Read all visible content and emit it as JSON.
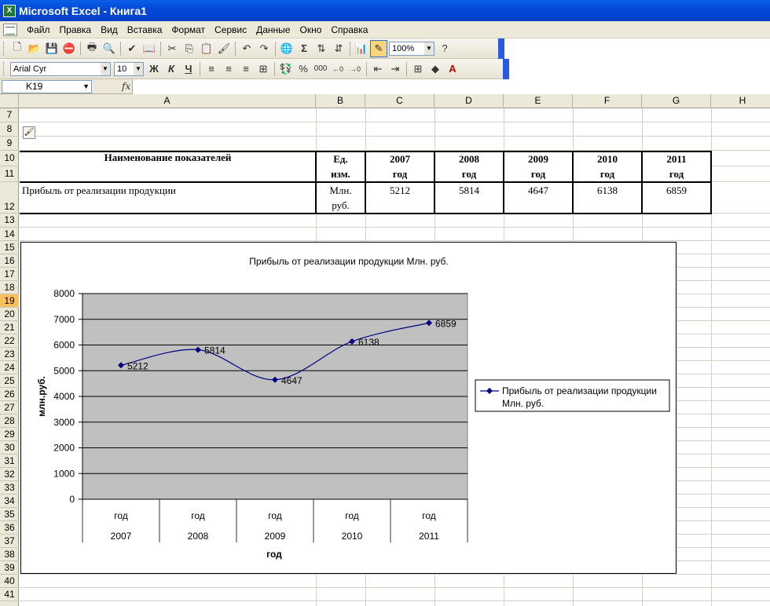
{
  "window": {
    "title": "Microsoft Excel - Книга1"
  },
  "menu": [
    "Файл",
    "Правка",
    "Вид",
    "Вставка",
    "Формат",
    "Сервис",
    "Данные",
    "Окно",
    "Справка"
  ],
  "toolbar": {
    "zoom": "100%",
    "font_name": "Arial Cyr",
    "font_size": "10",
    "bold": "Ж",
    "italic": "К",
    "underline": "Ч",
    "percent": "%",
    "thousands": "000",
    "sum": "Σ"
  },
  "namebox": {
    "cell": "K19",
    "fx": "fx"
  },
  "columns": [
    "A",
    "B",
    "C",
    "D",
    "E",
    "F",
    "G",
    "H"
  ],
  "rows": [
    "7",
    "8",
    "9",
    "10",
    "11",
    "12",
    "13",
    "14",
    "15",
    "16",
    "17",
    "18",
    "19",
    "20",
    "21",
    "22",
    "23",
    "24",
    "25",
    "26",
    "27",
    "28",
    "29",
    "30",
    "31",
    "32",
    "33",
    "34",
    "35",
    "36",
    "37",
    "38",
    "39",
    "40",
    "41"
  ],
  "selected_row": "19",
  "table": {
    "header_name": "Наименование показателей",
    "header_unit_1": "Ед.",
    "header_unit_2": "изм.",
    "years": [
      "2007",
      "2008",
      "2009",
      "2010",
      "2011"
    ],
    "year_word": "год",
    "row_label": "Прибыль от реализации продукции",
    "row_unit_1": "Млн.",
    "row_unit_2": "руб.",
    "values": [
      "5212",
      "5814",
      "4647",
      "6138",
      "6859"
    ]
  },
  "chart_data": {
    "type": "line",
    "title": "Прибыль от реализации продукции Млн. руб.",
    "categories": [
      "год 2007",
      "год 2008",
      "год 2009",
      "год 2010",
      "год 2011"
    ],
    "category_top": [
      "год",
      "год",
      "год",
      "год",
      "год"
    ],
    "category_bottom": [
      "2007",
      "2008",
      "2009",
      "2010",
      "2011"
    ],
    "series": [
      {
        "name": "Прибыль от реализации продукции Млн. руб.",
        "values": [
          5212,
          5814,
          4647,
          6138,
          6859
        ]
      }
    ],
    "data_labels": [
      "5212",
      "5814",
      "4647",
      "6138",
      "6859"
    ],
    "xlabel": "год",
    "ylabel": "млн.руб.",
    "ylim": [
      0,
      8000
    ],
    "yticks": [
      "0",
      "1000",
      "2000",
      "3000",
      "4000",
      "5000",
      "6000",
      "7000",
      "8000"
    ],
    "grid": true,
    "smooth": true,
    "legend": "right",
    "legend_line1": "Прибыль от реализации продукции",
    "legend_line2": "Млн. руб.",
    "plot_bg": "#c0c0c0",
    "line_color": "#000080"
  }
}
